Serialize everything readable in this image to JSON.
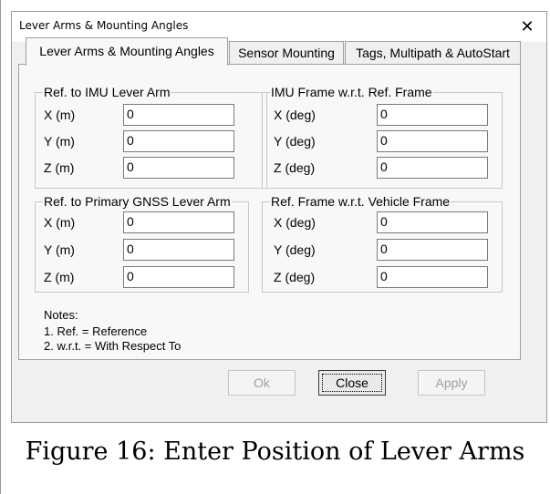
{
  "window": {
    "title": "Lever Arms & Mounting Angles",
    "close_glyph": "✕"
  },
  "tabs": [
    {
      "label": "Lever Arms & Mounting Angles",
      "active": true
    },
    {
      "label": "Sensor Mounting",
      "active": false
    },
    {
      "label": "Tags, Multipath & AutoStart",
      "active": false
    }
  ],
  "groups": {
    "imu_lever_arm": {
      "legend": "Ref. to IMU Lever Arm",
      "rows": [
        {
          "label": "X (m)",
          "value": "0"
        },
        {
          "label": "Y (m)",
          "value": "0"
        },
        {
          "label": "Z (m)",
          "value": "0"
        }
      ]
    },
    "imu_frame": {
      "legend": "IMU Frame w.r.t. Ref. Frame",
      "rows": [
        {
          "label": "X (deg)",
          "value": "0"
        },
        {
          "label": "Y (deg)",
          "value": "0"
        },
        {
          "label": "Z (deg)",
          "value": "0"
        }
      ]
    },
    "gnss_lever_arm": {
      "legend": "Ref. to Primary GNSS Lever Arm",
      "rows": [
        {
          "label": "X (m)",
          "value": "0"
        },
        {
          "label": "Y (m)",
          "value": "0"
        },
        {
          "label": "Z (m)",
          "value": "0"
        }
      ]
    },
    "vehicle_frame": {
      "legend": "Ref. Frame w.r.t. Vehicle Frame",
      "rows": [
        {
          "label": "X (deg)",
          "value": "0"
        },
        {
          "label": "Y (deg)",
          "value": "0"
        },
        {
          "label": "Z (deg)",
          "value": "0"
        }
      ]
    }
  },
  "notes": {
    "heading": "Notes:",
    "line1": "1. Ref. = Reference",
    "line2": "2. w.r.t. = With Respect To"
  },
  "buttons": {
    "ok": "Ok",
    "close": "Close",
    "apply": "Apply"
  },
  "caption": "Figure 16: Enter Position of Lever Arms"
}
